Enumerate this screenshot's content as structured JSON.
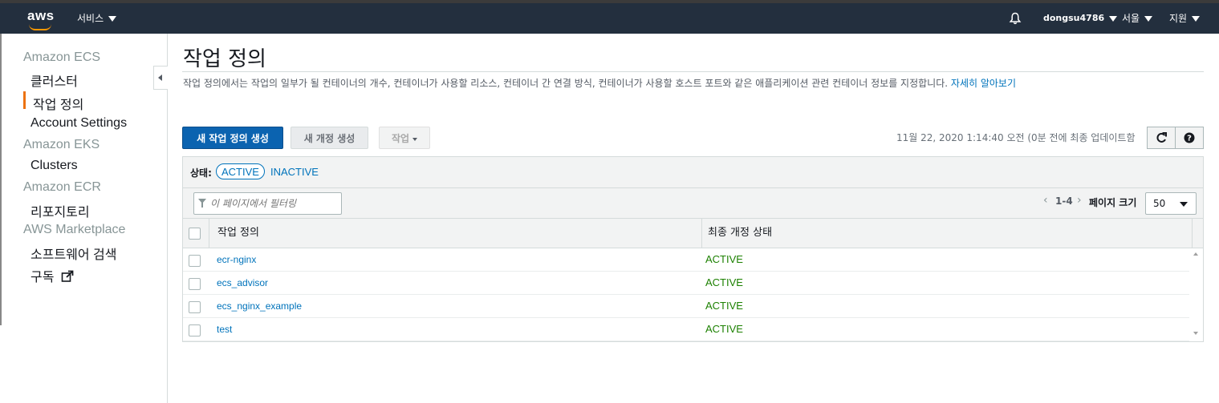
{
  "topbar": {
    "logo": "aws",
    "services_label": "서비스",
    "bell_icon": "bell-icon",
    "user": "dongsu4786",
    "region": "서울",
    "support": "지원"
  },
  "sidebar": {
    "groups": [
      {
        "label": "Amazon ECS",
        "items": [
          "클러스터",
          "작업 정의",
          "Account Settings"
        ]
      },
      {
        "label": "Amazon EKS",
        "items": [
          "Clusters"
        ]
      },
      {
        "label": "Amazon ECR",
        "items": [
          "리포지토리"
        ]
      },
      {
        "label": "AWS Marketplace",
        "items": [
          "소프트웨어 검색",
          "구독"
        ]
      }
    ],
    "active_item": "작업 정의",
    "external_link_icon": "external-link-icon"
  },
  "page": {
    "title": "작업 정의",
    "description": "작업 정의에서는 작업의 일부가 될 컨테이너의 개수, 컨테이너가 사용할 리소스, 컨테이너 간 연결 방식, 컨테이너가 사용할 호스트 포트와 같은 애플리케이션 관련 컨테이너 정보를 지정합니다.",
    "learn_more": "자세히 알아보기"
  },
  "toolbar": {
    "create_label": "새 작업 정의 생성",
    "revision_label": "새 개정 생성",
    "actions_label": "작업",
    "updated_text": "11월 22, 2020 1:14:40 오전 (0분 전에 최종 업데이트함",
    "refresh_icon": "refresh-icon",
    "help_icon": "help-icon"
  },
  "filters": {
    "status_label": "상태:",
    "active": "ACTIVE",
    "inactive": "INACTIVE",
    "search_placeholder": "이 페이지에서 필터링",
    "range": "1-4",
    "page_size_label": "페이지 크기",
    "page_size": "50"
  },
  "table": {
    "columns": [
      "작업 정의",
      "최종 개정 상태"
    ],
    "rows": [
      {
        "name": "ecr-nginx",
        "status": "ACTIVE"
      },
      {
        "name": "ecs_advisor",
        "status": "ACTIVE"
      },
      {
        "name": "ecs_nginx_example",
        "status": "ACTIVE"
      },
      {
        "name": "test",
        "status": "ACTIVE"
      }
    ]
  },
  "colors": {
    "header_bg": "#232f3e",
    "primary": "#0b63b0",
    "link": "#0073bb",
    "active_status": "#1d8102",
    "accent": "#ec7211"
  }
}
